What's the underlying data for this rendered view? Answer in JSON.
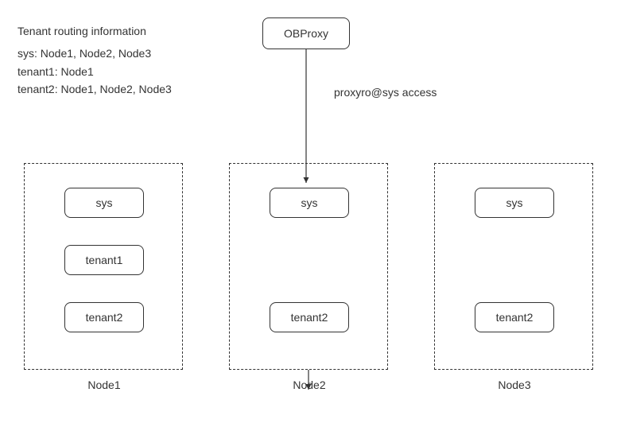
{
  "info": {
    "title": "Tenant routing information",
    "sys_line": "sys: Node1, Node2, Node3",
    "tenant1_line": "tenant1: Node1",
    "tenant2_line": "tenant2: Node1, Node2, Node3"
  },
  "proxy": {
    "label": "OBProxy",
    "arrow_label": "proxyro@sys access"
  },
  "nodes": {
    "node1": {
      "label": "Node1",
      "sys": "sys",
      "tenant1": "tenant1",
      "tenant2": "tenant2"
    },
    "node2": {
      "label": "Node2",
      "sys": "sys",
      "tenant2": "tenant2"
    },
    "node3": {
      "label": "Node3",
      "sys": "sys",
      "tenant2": "tenant2"
    }
  }
}
